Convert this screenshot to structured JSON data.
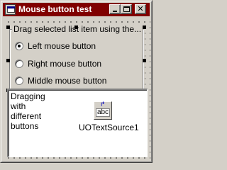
{
  "window": {
    "title": "Mouse button test",
    "app_icon": "form-icon",
    "title_bar_color": "#800000",
    "buttons": {
      "minimize": "minimize-icon",
      "maximize": "maximize-icon",
      "close_glyph": "✕"
    }
  },
  "group": {
    "caption": "Drag selected list item using the...",
    "options": [
      {
        "label": "Left mouse button",
        "selected": true
      },
      {
        "label": "Right mouse button",
        "selected": false
      },
      {
        "label": "Middle mouse button",
        "selected": false
      }
    ]
  },
  "memo": {
    "lines": [
      "Dragging",
      "with",
      "different",
      "buttons"
    ]
  },
  "component": {
    "icon_text": "abc",
    "icon_arrow": "↱",
    "name": "UOTextSource1"
  }
}
